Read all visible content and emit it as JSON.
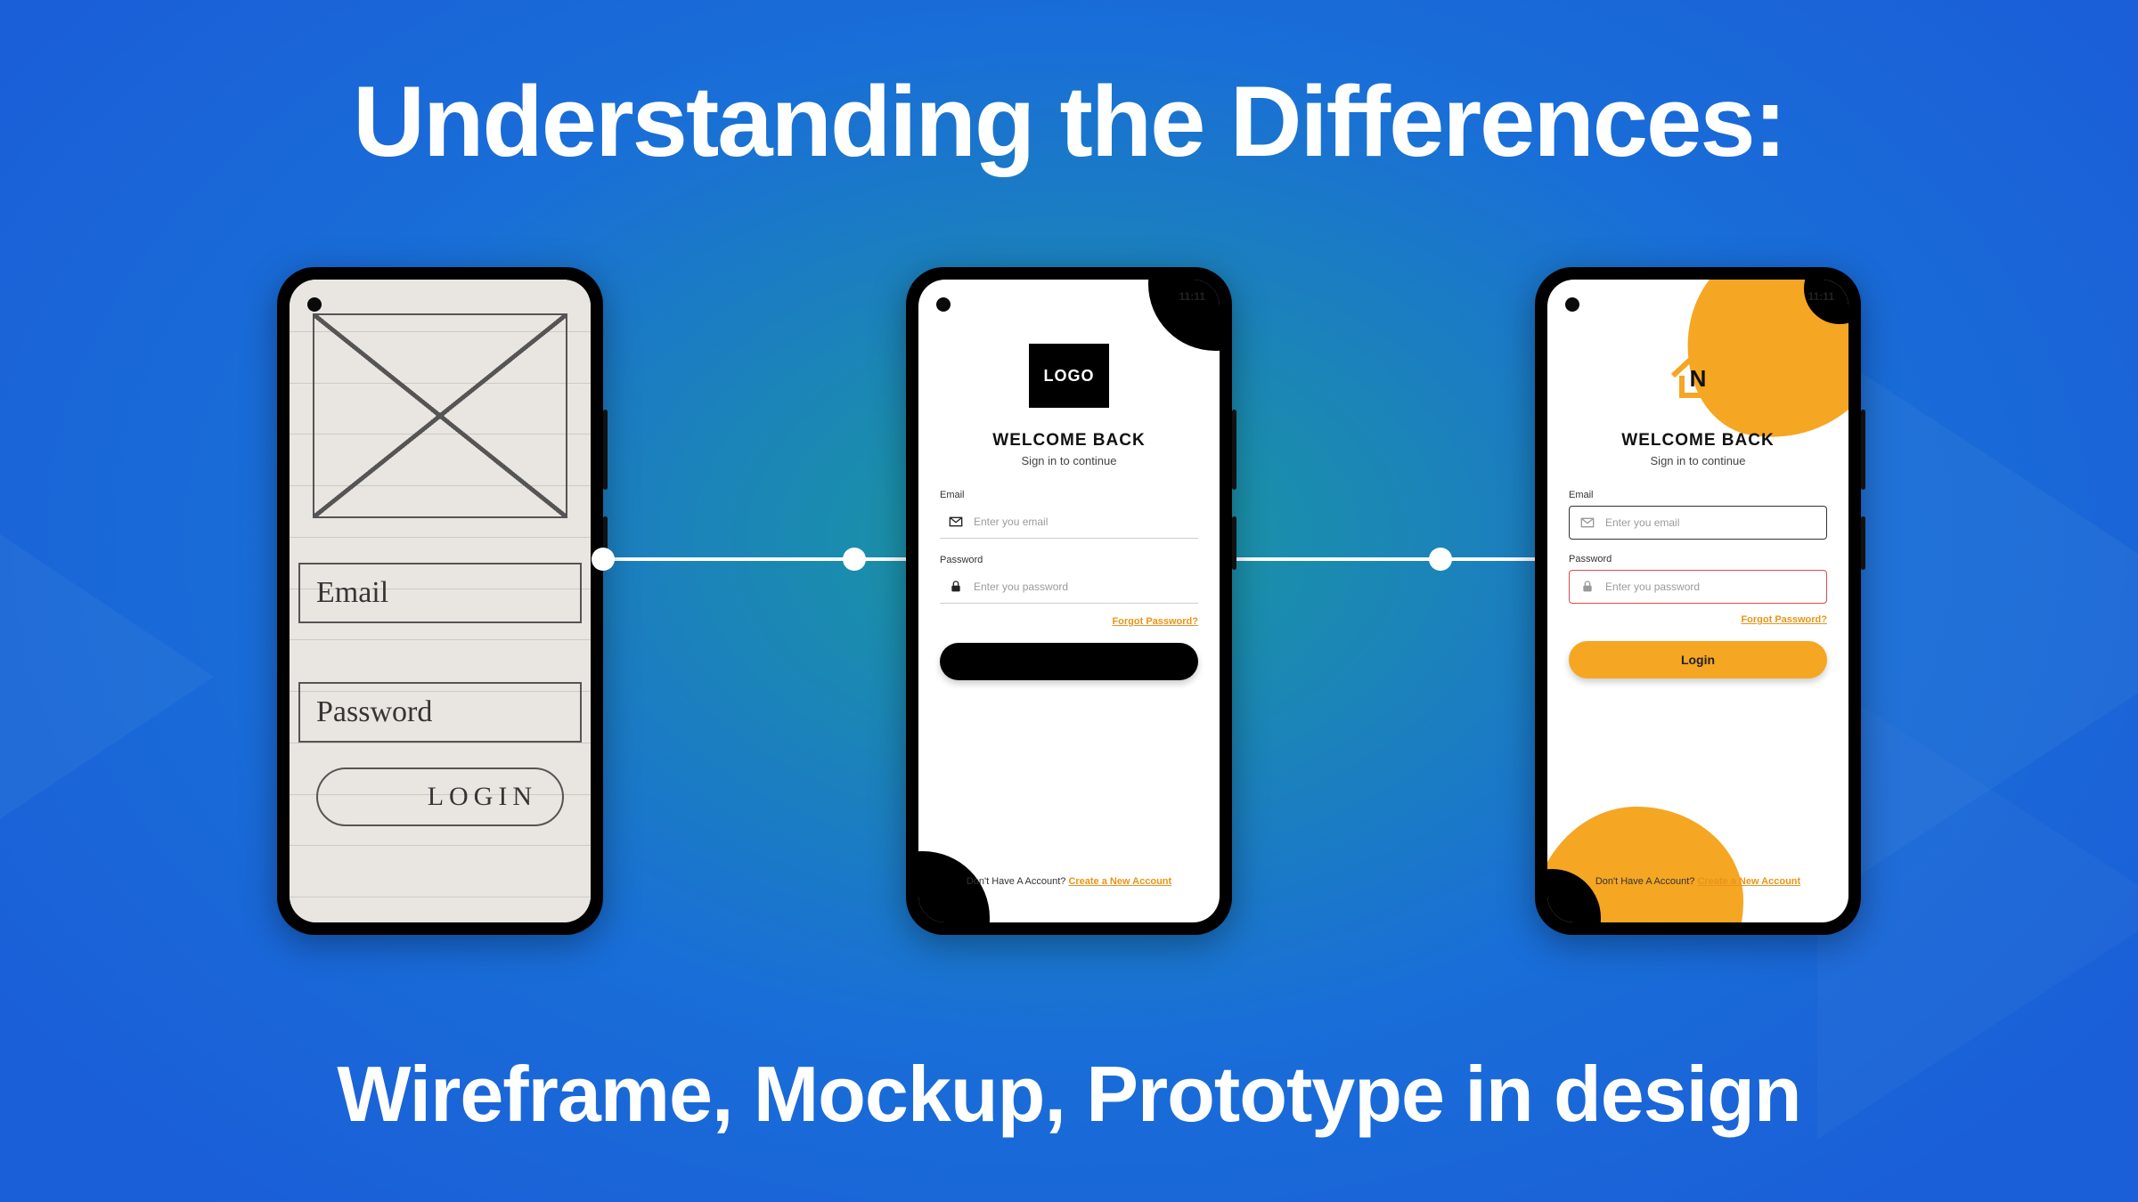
{
  "colors": {
    "accent_orange": "#f5a623",
    "error_red": "#d94c4c",
    "bg_blue": "#1a5fd8",
    "bg_teal": "#1a9a9d"
  },
  "title": "Understanding the Differences:",
  "subtitle": "Wireframe, Mockup, Prototype in design",
  "wireframe": {
    "email_label": "Email",
    "password_label": "Password",
    "login_label": "LOGIN"
  },
  "mockup": {
    "logo_text": "LOGO",
    "clock": "11:11",
    "welcome": "WELCOME BACK",
    "subwelcome": "Sign in to continue",
    "email_label": "Email",
    "email_placeholder": "Enter you email",
    "password_label": "Password",
    "password_placeholder": "Enter you password",
    "forgot": "Forgot Password?",
    "login_label": "",
    "no_account_prefix": "Don't Have A Account? ",
    "create_account": "Create a New Account"
  },
  "prototype": {
    "logo_letter": "N",
    "clock": "11:11",
    "welcome": "WELCOME BACK",
    "subwelcome": "Sign in to continue",
    "email_label": "Email",
    "email_placeholder": "Enter you email",
    "password_label": "Password",
    "password_placeholder": "Enter you password",
    "forgot": "Forgot Password?",
    "login_label": "Login",
    "no_account_prefix": "Don't Have A Account? ",
    "create_account": "Create a New Account"
  }
}
